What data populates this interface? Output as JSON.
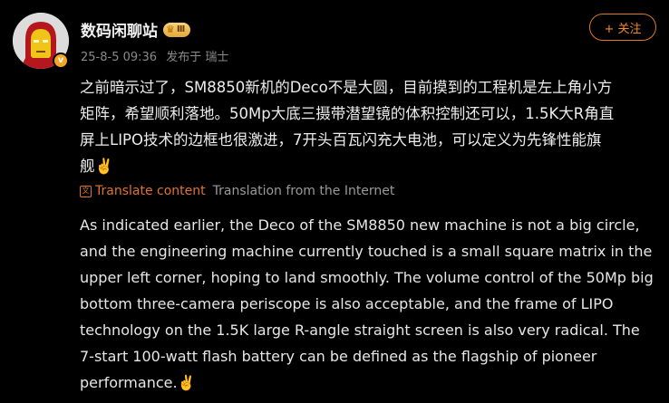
{
  "user": {
    "name": "数码闲聊站",
    "level_badge": "Ⅲ",
    "verified_icon": "v-icon"
  },
  "meta": {
    "timestamp": "25-8-5 09:36",
    "posted_from": "发布于 瑞士"
  },
  "follow_button": {
    "label": "+ 关注"
  },
  "post": {
    "text": "之前暗示过了，SM8850新机的Deco不是大圆，目前摸到的工程机是左上角小方\n矩阵，希望顺利落地。50Mp大底三摄带潜望镜的体积控制还可以，1.5K大R角直\n屏上LIPO技术的边框也很激进，7开头百瓦闪充大电池，可以定义为先锋性能旗\n舰✌️"
  },
  "translation": {
    "link_label": "Translate content",
    "source_note": "Translation from the Internet",
    "text": "As indicated earlier, the Deco of the SM8850 new machine is not a big circle,\nand the engineering machine currently touched is a small square matrix in the\nupper left corner, hoping to land smoothly. The volume control of the 50Mp big\nbottom three-camera periscope is also acceptable, and the frame of LIPO\ntechnology on the 1.5K large R-angle straight screen is also very radical. The\n7-start 100-watt flash battery can be defined as the flagship of pioneer\nperformance.✌️"
  },
  "colors": {
    "accent": "#e0742a",
    "background": "#000000"
  }
}
